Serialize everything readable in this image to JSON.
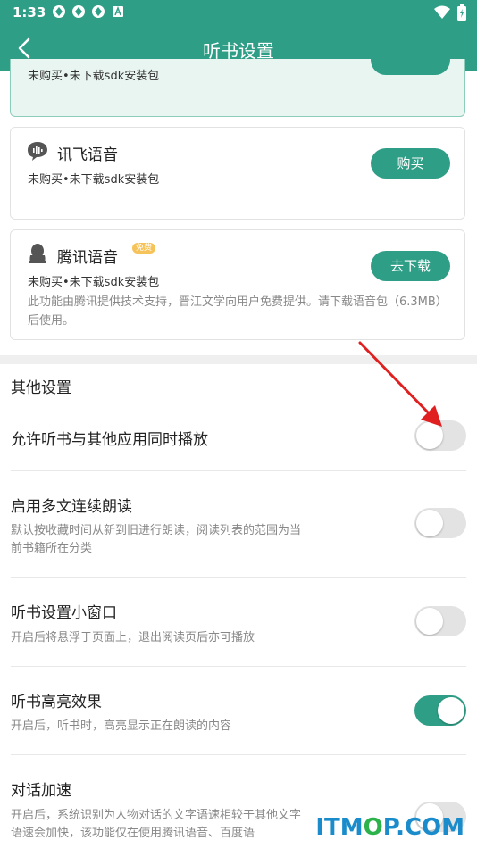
{
  "status_bar": {
    "time": "1:33"
  },
  "header": {
    "title": "听书设置"
  },
  "cards": [
    {
      "sub": "未购买•未下载sdk安装包"
    },
    {
      "name": "讯飞语音",
      "sub": "未购买•未下载sdk安装包",
      "button": "购买"
    },
    {
      "name": "腾讯语音",
      "badge": "免费",
      "sub": "未购买•未下载sdk安装包",
      "button": "去下载",
      "desc": "此功能由腾讯提供技术支持，晋江文学向用户免费提供。请下载语音包（6.3MB）后使用。"
    }
  ],
  "other": {
    "title": "其他设置",
    "rows": [
      {
        "label": "允许听书与其他应用同时播放",
        "desc": "",
        "on": false
      },
      {
        "label": "启用多文连续朗读",
        "desc": "默认按收藏时间从新到旧进行朗读，阅读列表的范围为当前书籍所在分类",
        "on": false
      },
      {
        "label": "听书设置小窗口",
        "desc": "开启后将悬浮于页面上，退出阅读页后亦可播放",
        "on": false
      },
      {
        "label": "听书高亮效果",
        "desc": "开启后，听书时，高亮显示正在朗读的内容",
        "on": true
      },
      {
        "label": "对话加速",
        "desc": "开启后，系统识别为人物对话的文字语速相较于其他文字语速会加快，该功能仅在使用腾讯语音、百度语",
        "on": false
      }
    ]
  },
  "watermark": "ITMOP.COM",
  "colors": {
    "primary": "#2f9e86",
    "toggle_off": "#e3e3e3",
    "annotation_arrow": "#e02020"
  }
}
